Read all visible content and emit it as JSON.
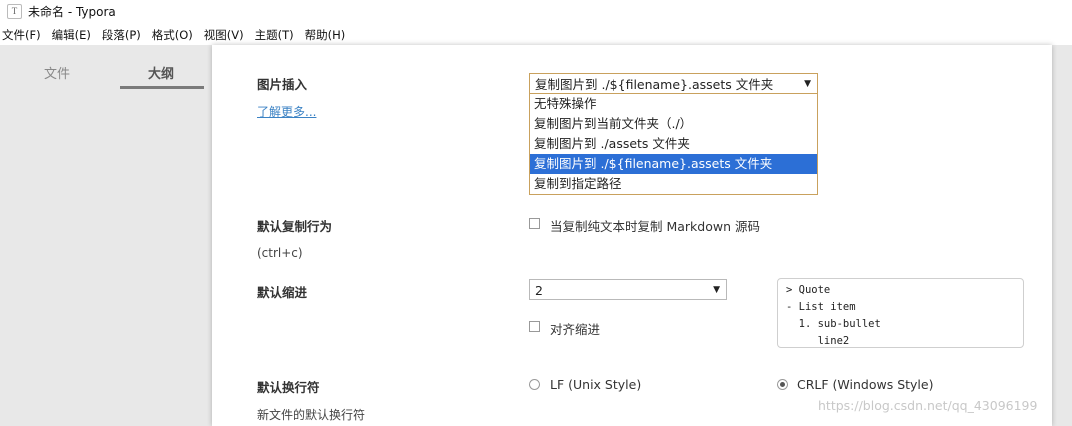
{
  "window": {
    "title": "未命名 - Typora",
    "icon_letter": "T"
  },
  "menubar": [
    "文件(F)",
    "编辑(E)",
    "段落(P)",
    "格式(O)",
    "视图(V)",
    "主题(T)",
    "帮助(H)"
  ],
  "sidebar": {
    "tabs": [
      "文件",
      "大纲"
    ],
    "active_tab": "大纲"
  },
  "image_insert": {
    "label": "图片插入",
    "link": "了解更多...",
    "selected_value": "复制图片到 ./${filename}.assets 文件夹",
    "options": [
      "无特殊操作",
      "复制图片到当前文件夹（./）",
      "复制图片到 ./assets 文件夹",
      "复制图片到 ./${filename}.assets 文件夹",
      "复制到指定路径"
    ],
    "highlighted_index": 3
  },
  "copy_behavior": {
    "label": "默认复制行为",
    "sub": "(ctrl+c)",
    "checkbox_label": "当复制纯文本时复制 Markdown 源码",
    "checked": false
  },
  "indent": {
    "label": "默认缩进",
    "value": "2",
    "align_label": "对齐缩进",
    "align_checked": false,
    "preview_lines": [
      "> Quote",
      "- List item",
      "  1. sub-bullet",
      "     line2"
    ]
  },
  "line_ending": {
    "label": "默认换行符",
    "sub": "新文件的默认换行符",
    "option_lf": "LF (Unix Style)",
    "option_crlf": "CRLF (Windows Style)",
    "selected": "CRLF (Windows Style)"
  },
  "watermark": "https://blog.csdn.net/qq_43096199"
}
